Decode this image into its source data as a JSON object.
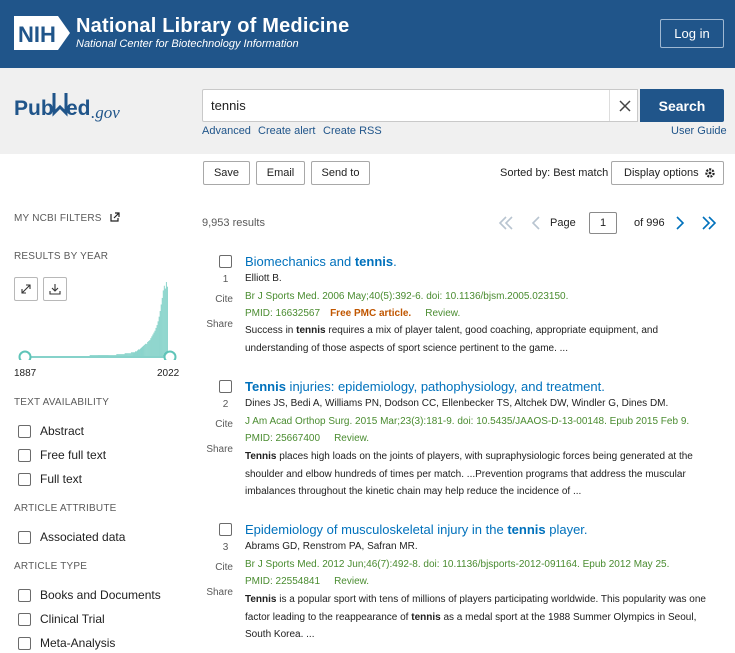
{
  "nih": {
    "title": "National Library of Medicine",
    "subtitle": "National Center for Biotechnology Information",
    "login_label": "Log in"
  },
  "search": {
    "query": "tennis",
    "button_label": "Search",
    "links": [
      "Advanced",
      "Create alert",
      "Create RSS"
    ],
    "user_guide": "User Guide"
  },
  "toolbar": {
    "save": "Save",
    "email": "Email",
    "send_to": "Send to",
    "sorted_by": "Sorted by: Best match",
    "display_options": "Display options"
  },
  "sidebar": {
    "my_ncbi_filters": "MY NCBI FILTERS",
    "results_by_year": "RESULTS BY YEAR",
    "year_start": "1887",
    "year_end": "2022",
    "text_availability": "TEXT AVAILABILITY",
    "text_options": [
      "Abstract",
      "Free full text",
      "Full text"
    ],
    "article_attribute": "ARTICLE ATTRIBUTE",
    "attribute_options": [
      "Associated data"
    ],
    "article_type": "ARTICLE TYPE",
    "type_options": [
      "Books and Documents",
      "Clinical Trial",
      "Meta-Analysis"
    ],
    "histogram": [
      0,
      0,
      0,
      0,
      0,
      0,
      0,
      0,
      0,
      0,
      0,
      0,
      0,
      0,
      0,
      0,
      0,
      0,
      0,
      0,
      0,
      0,
      0,
      0,
      0,
      0,
      0,
      0,
      0,
      0,
      0,
      0,
      0,
      0,
      0,
      0,
      0,
      0,
      0,
      0,
      0,
      0,
      0,
      0,
      0,
      0,
      0,
      0,
      0,
      0,
      0,
      0,
      0,
      0,
      0,
      0,
      0,
      0,
      0,
      0,
      1,
      1,
      1,
      1,
      1,
      1,
      1,
      1,
      1,
      1,
      1,
      1,
      1,
      1,
      1,
      1,
      1,
      1,
      1,
      1,
      1,
      1,
      1,
      1,
      1,
      1,
      2,
      2,
      2,
      2,
      2,
      2,
      2,
      2,
      3,
      3,
      3,
      3,
      3,
      3,
      4,
      4,
      4,
      4,
      5,
      5,
      6,
      7,
      7,
      8,
      9,
      10,
      11,
      12,
      13,
      13,
      15,
      16,
      17,
      19,
      21,
      23,
      25,
      27,
      30,
      33,
      37,
      42,
      48,
      55,
      62,
      70,
      75,
      72,
      79,
      74
    ]
  },
  "results": {
    "count": "9,953 results",
    "page_label": "Page",
    "page_value": "1",
    "of_pages": "of 996",
    "items": [
      {
        "num": "1",
        "title_before": "Biomechanics and ",
        "title_bold": "tennis",
        "title_after": ".",
        "authors": "Elliott B.",
        "citation": "Br J Sports Med. 2006 May;40(5):392-6. doi: 10.1136/bjsm.2005.023150.",
        "pmid": "PMID: 16632567",
        "free": "Free PMC article.",
        "type": "Review.",
        "snippet_html": "Success in <b>tennis</b> requires a mix of player talent, good coaching, appropriate equipment, and understanding of those aspects of sport science pertinent to the game. ..."
      },
      {
        "num": "2",
        "title_before": "",
        "title_bold": "Tennis",
        "title_after": " injuries: epidemiology, pathophysiology, and treatment.",
        "authors": "Dines JS, Bedi A, Williams PN, Dodson CC, Ellenbecker TS, Altchek DW, Windler G, Dines DM.",
        "citation": "J Am Acad Orthop Surg. 2015 Mar;23(3):181-9. doi: 10.5435/JAAOS-D-13-00148. Epub 2015 Feb 9.",
        "pmid": "PMID: 25667400",
        "free": "",
        "type": "Review.",
        "snippet_html": "<b>Tennis</b> places high loads on the joints of players, with supraphysiologic forces being generated at the shoulder and elbow hundreds of times per match. ...Prevention programs that address the muscular imbalances throughout the kinetic chain may help reduce the incidence of ..."
      },
      {
        "num": "3",
        "title_before": "Epidemiology of musculoskeletal injury in the ",
        "title_bold": "tennis",
        "title_after": " player.",
        "authors": "Abrams GD, Renstrom PA, Safran MR.",
        "citation": "Br J Sports Med. 2012 Jun;46(7):492-8. doi: 10.1136/bjsports-2012-091164. Epub 2012 May 25.",
        "pmid": "PMID: 22554841",
        "free": "",
        "type": "Review.",
        "snippet_html": "<b>Tennis</b> is a popular sport with tens of millions of players participating worldwide. This popularity was one factor leading to the reappearance of <b>tennis</b> as a medal sport at the 1988 Summer Olympics in Seoul, South Korea. ..."
      }
    ],
    "actions": [
      "Cite",
      "Share"
    ]
  },
  "colors": {
    "nih_blue": "#20558a",
    "link_blue": "#0071bc",
    "citation_green": "#4a8c30",
    "free_orange": "#c05600",
    "histogram_teal": "#5fc4b8"
  }
}
